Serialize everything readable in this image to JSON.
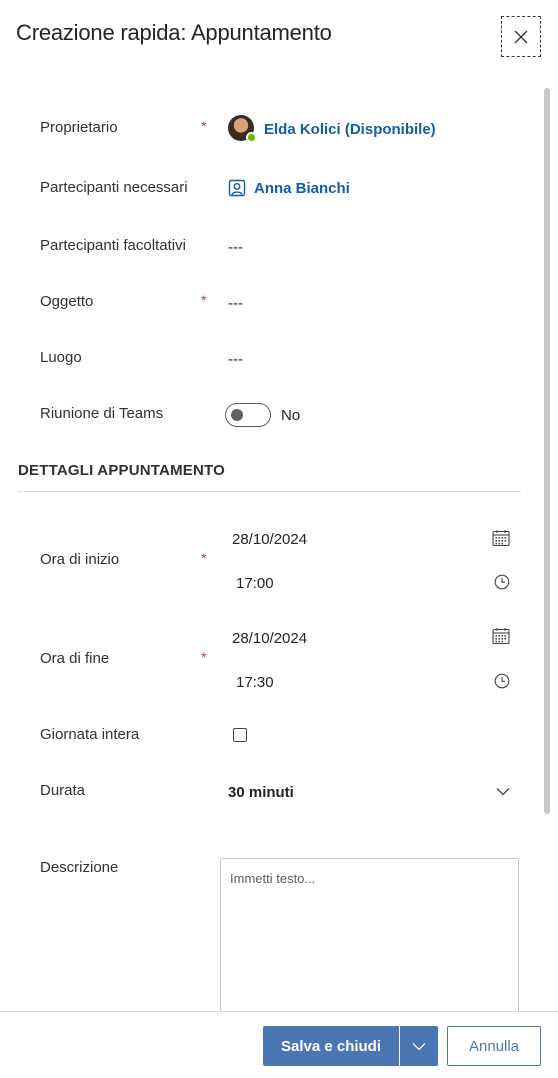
{
  "dialog": {
    "title": "Creazione rapida: Appuntamento",
    "close_icon": "close-icon"
  },
  "form": {
    "owner": {
      "label": "Proprietario",
      "required": "*",
      "value": "Elda Kolici (Disponibile)",
      "presence": "available",
      "presence_color": "#6bb700"
    },
    "required_attendees": {
      "label": "Partecipanti necessari",
      "value": "Anna Bianchi",
      "icon": "contact-icon"
    },
    "optional_attendees": {
      "label": "Partecipanti facoltativi",
      "value": "---"
    },
    "subject": {
      "label": "Oggetto",
      "required": "*",
      "value": "---"
    },
    "location": {
      "label": "Luogo",
      "value": "---"
    },
    "teams_meeting": {
      "label": "Riunione di Teams",
      "state": "No",
      "enabled": false
    }
  },
  "details": {
    "section_title": "DETTAGLI APPUNTAMENTO",
    "start": {
      "label": "Ora di inizio",
      "required": "*",
      "date": "28/10/2024",
      "time": "17:00"
    },
    "end": {
      "label": "Ora di fine",
      "required": "*",
      "date": "28/10/2024",
      "time": "17:30"
    },
    "all_day": {
      "label": "Giornata intera",
      "checked": false
    },
    "duration": {
      "label": "Durata",
      "value": "30 minuti"
    },
    "description": {
      "label": "Descrizione",
      "placeholder": "Immetti testo..."
    }
  },
  "footer": {
    "save_label": "Salva e chiudi",
    "cancel_label": "Annulla"
  },
  "colors": {
    "accent": "#4a77b4",
    "link": "#115ea3",
    "required": "#c4314b"
  }
}
